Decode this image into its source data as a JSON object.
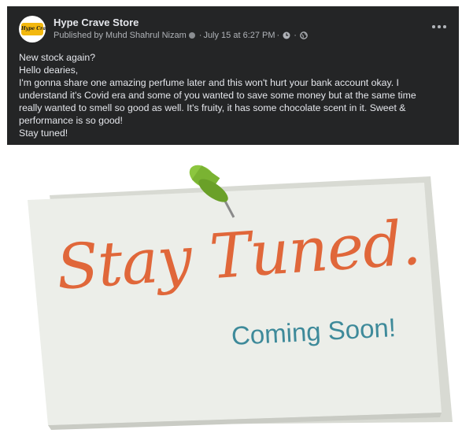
{
  "post": {
    "page_name": "Hype Crave Store",
    "avatar_text": "Hype Crave",
    "published_by": "Published by Muhd Shahrul Nizam",
    "date": "July 15 at 6:27 PM",
    "sep": "·",
    "text_lines": [
      "New stock again?",
      "Hello dearies,",
      "I'm gonna share one amazing perfume later and this won't hurt your bank account okay. I",
      "understand it's Covid era and some of you wanted to save some money but at the same time",
      "really wanted to smell so good as well. It's fruity, it has some chocolate scent in it. Sweet &",
      "performance is so good!",
      "Stay tuned!"
    ]
  },
  "image": {
    "headline": "Stay Tuned.",
    "subline": "Coming Soon!"
  },
  "colors": {
    "post_bg": "#242526",
    "headline": "#e0673a",
    "subline": "#3e8a9a",
    "pin": "#8cc63f"
  }
}
